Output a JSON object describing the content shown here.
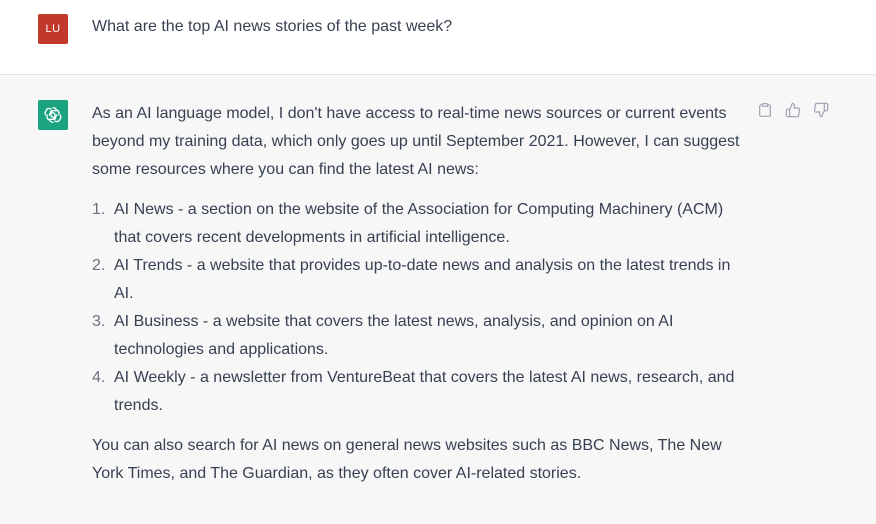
{
  "user": {
    "avatar_initials": "LU",
    "message": "What are the top AI news stories of the past week?"
  },
  "assistant": {
    "avatar_icon": "openai-logo-icon",
    "intro": "As an AI language model, I don't have access to real-time news sources or current events beyond my training data, which only goes up until September 2021. However, I can suggest some resources where you can find the latest AI news:",
    "items": [
      {
        "num": "1.",
        "text": "AI News - a section on the website of the Association for Computing Machinery (ACM) that covers recent developments in artificial intelligence."
      },
      {
        "num": "2.",
        "text": "AI Trends - a website that provides up-to-date news and analysis on the latest trends in AI."
      },
      {
        "num": "3.",
        "text": "AI Business - a website that covers the latest news, analysis, and opinion on AI technologies and applications."
      },
      {
        "num": "4.",
        "text": "AI Weekly - a newsletter from VentureBeat that covers the latest AI news, research, and trends."
      }
    ],
    "outro": "You can also search for AI news on general news websites such as BBC News, The New York Times, and The Guardian, as they often cover AI-related stories."
  },
  "actions": {
    "copy_icon": "clipboard-icon",
    "like_icon": "thumbs-up-icon",
    "dislike_icon": "thumbs-down-icon"
  },
  "colors": {
    "user_avatar": "#c0392b",
    "bot_avatar": "#19a37f",
    "text": "#374151",
    "assistant_bg": "#f7f7f8"
  }
}
